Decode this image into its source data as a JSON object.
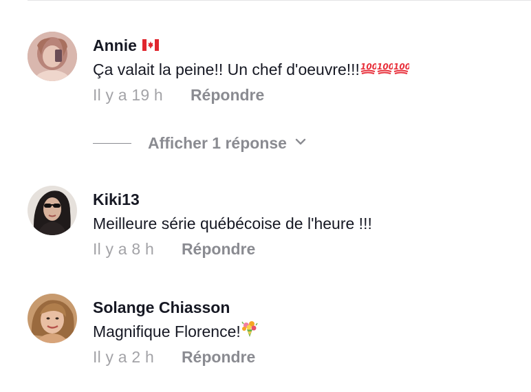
{
  "comments": [
    {
      "author": "Annie",
      "author_flag": "canada-flag-icon",
      "text": "Ça valait la peine!! Un chef d'oeuvre!!!",
      "emoji": [
        "hundred-points-icon",
        "hundred-points-icon",
        "hundred-points-icon"
      ],
      "time": "Il y a 19 h",
      "reply_label": "Répondre",
      "replies_label": "Afficher 1 réponse"
    },
    {
      "author": "Kiki13",
      "text": "Meilleure série québécoise de l'heure !!!",
      "time": "Il y a 8 h",
      "reply_label": "Répondre"
    },
    {
      "author": "Solange Chiasson",
      "text": "Magnifique Florence!",
      "emoji": [
        "bouquet-icon"
      ],
      "time": "Il y a 2 h",
      "reply_label": "Répondre"
    }
  ],
  "colors": {
    "primary_text": "#161823",
    "secondary_text": "#8a8b91",
    "time_text": "#a3a3a7",
    "hundred_red": "#e8303b"
  }
}
